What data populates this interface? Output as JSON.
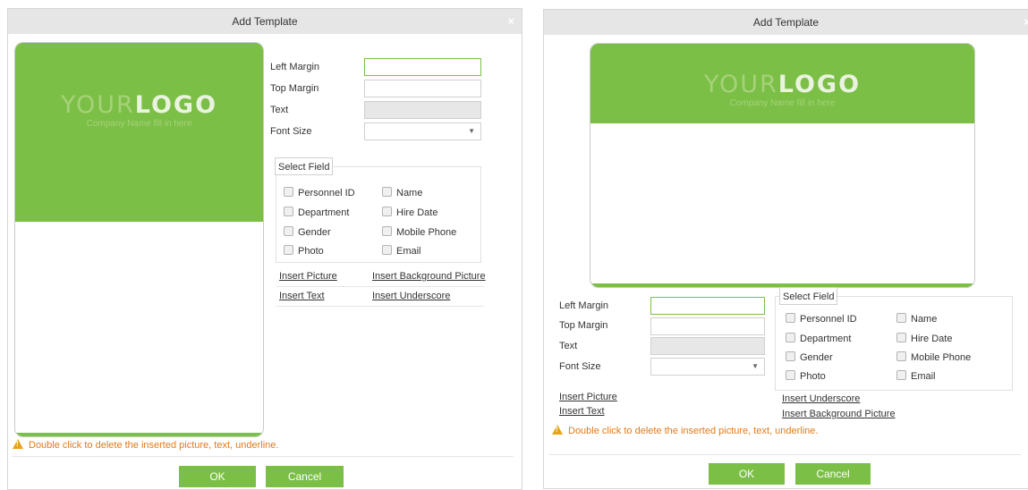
{
  "dialog1": {
    "title": "Add Template",
    "close": "×",
    "logo": {
      "word1": "YOUR",
      "word2": "LOGO",
      "company": "Company Name fill in here"
    },
    "form": {
      "left_margin": "Left Margin",
      "top_margin": "Top Margin",
      "text": "Text",
      "font_size": "Font Size",
      "dropdown_arrow": "▼"
    },
    "select_field": {
      "legend": "Select Field",
      "options": [
        "Personnel ID",
        "Name",
        "Department",
        "Hire Date",
        "Gender",
        "Mobile Phone",
        "Photo",
        "Email"
      ]
    },
    "links": {
      "insert_picture": "Insert Picture",
      "insert_background_picture": "Insert Background Picture",
      "insert_text": "Insert Text",
      "insert_underscore": "Insert Underscore"
    },
    "warning": "Double click to delete the inserted picture, text, underline.",
    "ok": "OK",
    "cancel": "Cancel"
  },
  "dialog2": {
    "title": "Add Template",
    "close": "×",
    "logo": {
      "word1": "YOUR",
      "word2": "LOGO",
      "company": "Company Name fill in here"
    },
    "form": {
      "left_margin": "Left Margin",
      "top_margin": "Top Margin",
      "text": "Text",
      "font_size": "Font Size",
      "dropdown_arrow": "▼"
    },
    "select_field": {
      "legend": "Select Field",
      "options": [
        "Personnel ID",
        "Name",
        "Department",
        "Hire Date",
        "Gender",
        "Mobile Phone",
        "Photo",
        "Email"
      ]
    },
    "links": {
      "insert_picture": "Insert Picture",
      "insert_text": "Insert Text",
      "insert_underscore": "Insert Underscore",
      "insert_background_picture": "Insert Background Picture"
    },
    "warning": "Double click to delete the inserted picture, text, underline.",
    "ok": "OK",
    "cancel": "Cancel"
  },
  "colors": {
    "accent": "#7bbf46",
    "warning": "#e07b1a",
    "titlebar": "#e6e6e6"
  }
}
